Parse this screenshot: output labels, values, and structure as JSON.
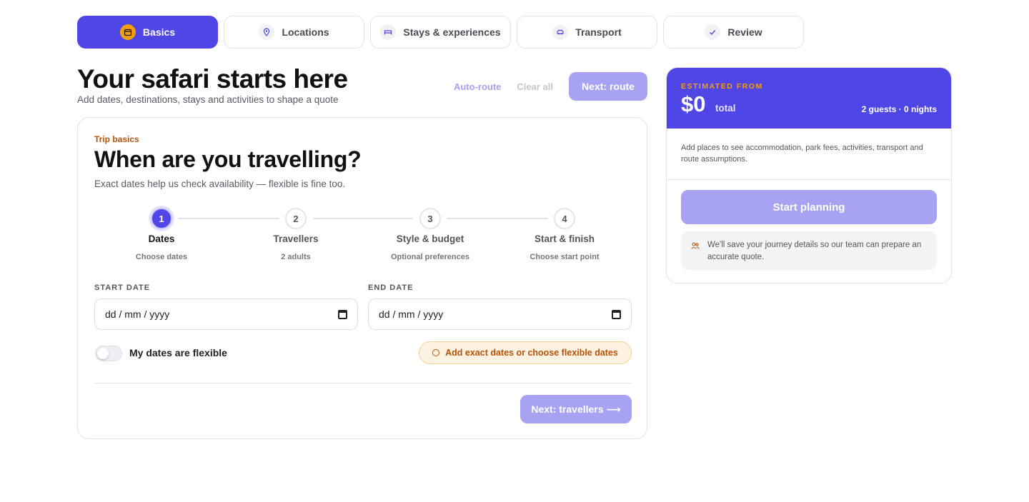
{
  "tabs": [
    {
      "label": "Basics",
      "icon": "calendar-icon",
      "active": true
    },
    {
      "label": "Locations",
      "icon": "map-pin-icon",
      "active": false
    },
    {
      "label": "Stays & experiences",
      "icon": "bed-icon",
      "active": false
    },
    {
      "label": "Transport",
      "icon": "car-icon",
      "active": false
    },
    {
      "label": "Review",
      "icon": "check-icon",
      "active": false
    }
  ],
  "header": {
    "title": "Your safari starts here",
    "subtitle": "Add dates, destinations, stays and activities to shape a quote",
    "auto_route": "Auto-route",
    "clear_all": "Clear all",
    "next_route": "Next: route"
  },
  "card": {
    "kicker": "Trip basics",
    "title": "When are you travelling?",
    "subtitle": "Exact dates help us check availability — flexible is fine too.",
    "steps": [
      {
        "num": "1",
        "title": "Dates",
        "desc": "Choose dates"
      },
      {
        "num": "2",
        "title": "Travellers",
        "desc": "2 adults"
      },
      {
        "num": "3",
        "title": "Style & budget",
        "desc": "Optional preferences"
      },
      {
        "num": "4",
        "title": "Start & finish",
        "desc": "Choose start point"
      }
    ],
    "start_date_label": "START DATE",
    "end_date_label": "END DATE",
    "start_date_placeholder": "dd / mm / yyyy",
    "end_date_placeholder": "dd / mm / yyyy",
    "flexible_label": "My dates are flexible",
    "flexible_on": false,
    "hint": "Add exact dates or choose flexible dates",
    "next_travellers": "Next: travellers",
    "next_arrow": "⟶"
  },
  "summary": {
    "estimated_label": "ESTIMATED FROM",
    "price": "$0",
    "total_label": "total",
    "guests_nights": "2 guests · 0 nights",
    "note": "Add places to see accommodation, park fees, activities, transport and route assumptions.",
    "start_planning": "Start planning",
    "save_note": "We'll save your journey details so our team can prepare an accurate quote."
  },
  "colors": {
    "accent": "#4f46e5",
    "accent_disabled": "#a7a3f2",
    "amber": "#f59e0b",
    "amber_text": "#b45309"
  }
}
